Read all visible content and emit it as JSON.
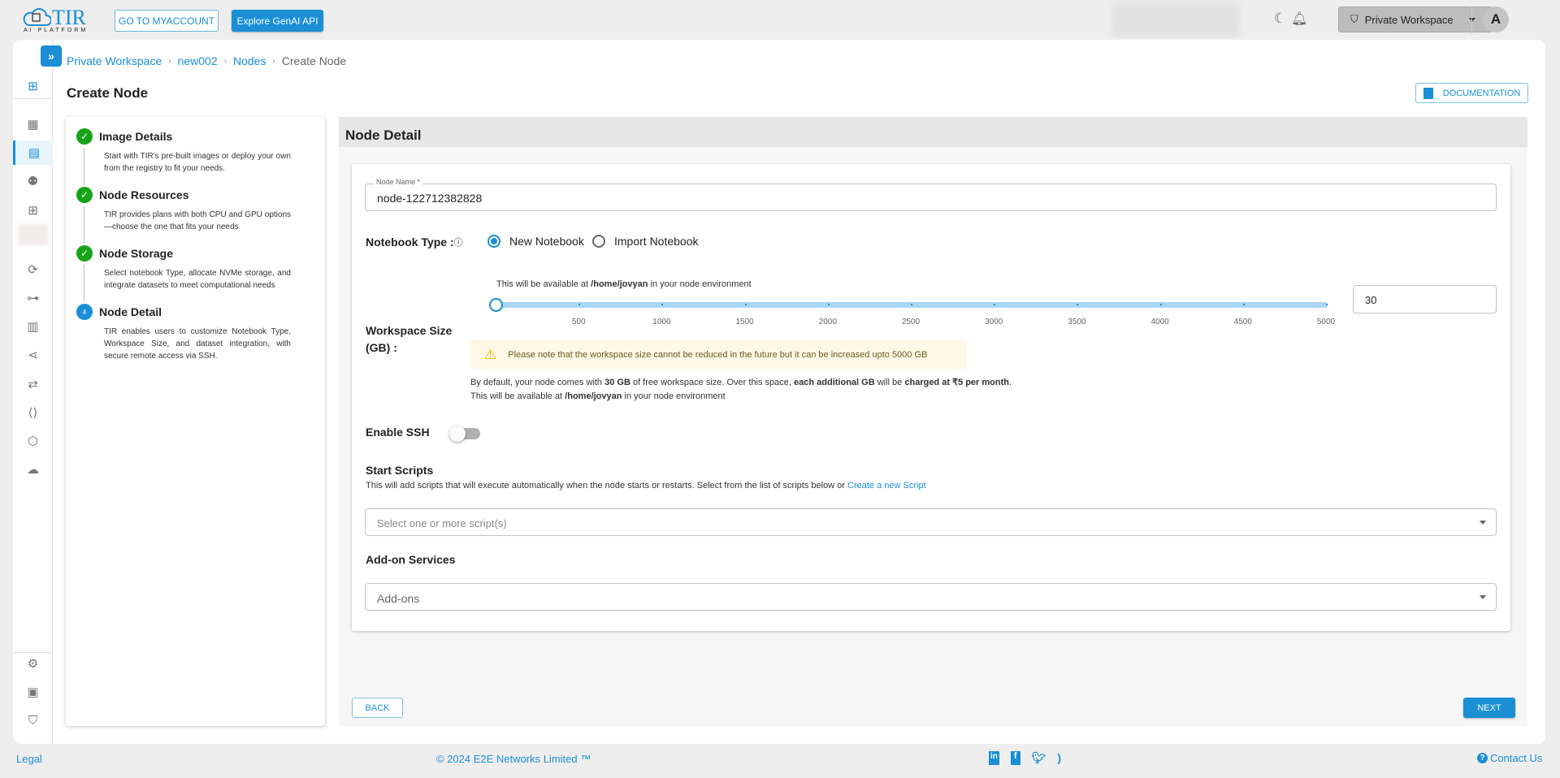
{
  "header": {
    "logo_text": "TIR",
    "logo_sub": "AI PLATFORM",
    "myaccount_label": "GO TO MYACCOUNT",
    "genai_label": "Explore GenAI API",
    "workspace_label": "Private Workspace",
    "avatar_letter": "A"
  },
  "breadcrumb": [
    "Private Workspace",
    "new002",
    "Nodes",
    "Create Node"
  ],
  "page_title": "Create Node",
  "documentation_label": "DOCUMENTATION",
  "steps": [
    {
      "title": "Image Details",
      "desc": "Start with TIR's pre-built images or deploy your own from the registry to fit your needs.",
      "status": "done"
    },
    {
      "title": "Node Resources",
      "desc": "TIR provides plans with both CPU and GPU options—choose the one that fits your needs",
      "status": "done"
    },
    {
      "title": "Node Storage",
      "desc": "Select notebook Type, allocate NVMe storage, and integrate datasets to meet computational needs",
      "status": "done"
    },
    {
      "title": "Node Detail",
      "desc": "TIR enables users to customize Notebook Type, Workspace Size, and dataset integration, with secure remote access via SSH.",
      "status": "active",
      "number": "4"
    }
  ],
  "form": {
    "section_title": "Node Detail",
    "node_name_label": "Node Name *",
    "node_name_value": "node-122712382828",
    "notebook_type_label": "Notebook Type :",
    "notebook_options": [
      "New Notebook",
      "Import Notebook"
    ],
    "notebook_selected": "New Notebook",
    "workspace_label": "Workspace Size (GB) :",
    "workspace_hint_pre": "This will be available at ",
    "workspace_hint_path": "/home/jovyan",
    "workspace_hint_post": " in your node environment",
    "slider_min": 0,
    "slider_max": 5000,
    "slider_value": 30,
    "slider_ticks": [
      "500",
      "1000",
      "1500",
      "2000",
      "2500",
      "3000",
      "3500",
      "4000",
      "4500",
      "5000"
    ],
    "workspace_value": "30",
    "warning": "Please note that the workspace size cannot be reduced in the future but it can be increased upto 5000 GB",
    "info1_a": "By default, your node comes with ",
    "info1_b": "30 GB",
    "info1_c": " of free workspace size. Over this space, ",
    "info1_d": "each additional GB",
    "info1_e": " will be ",
    "info1_f": "charged at ₹5 per month",
    "enable_ssh_label": "Enable SSH",
    "ssh_enabled": false,
    "start_scripts_label": "Start Scripts",
    "start_scripts_desc": "This will add scripts that will execute automatically when the node starts or restarts. Select from the list of scripts below or ",
    "create_script_link": "Create a new Script",
    "scripts_placeholder": "Select one or more script(s)",
    "addon_label": "Add-on Services",
    "addon_placeholder": "Add-ons",
    "back_label": "BACK",
    "next_label": "NEXT"
  },
  "footer": {
    "legal": "Legal",
    "copyright": "© 2024 E2E Networks Limited ™",
    "contact": "Contact Us"
  },
  "colors": {
    "accent": "#1a8fd6",
    "success": "#17a317",
    "warning_bg": "#fff8e6"
  }
}
